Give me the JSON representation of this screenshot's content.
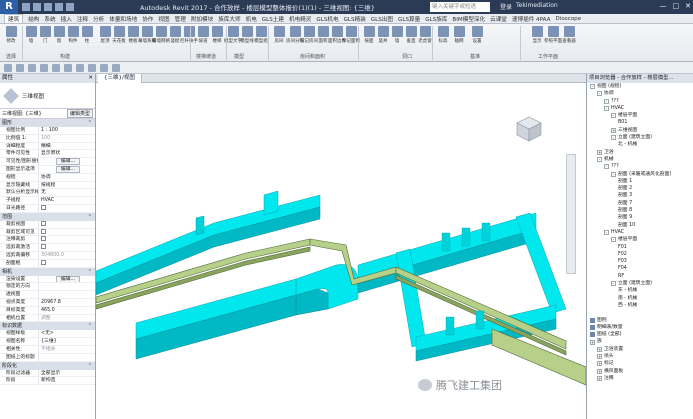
{
  "titlebar": {
    "logo": "R",
    "title": "Autodesk Revit 2017 -      合作放样 - 楼层模型整体报价(1)(1) - 三维视图: {三维}",
    "search_placeholder": "键入关键字或短语",
    "right_items": [
      "登录",
      "Tekimediation"
    ],
    "window_controls": [
      "—",
      "□",
      "✕"
    ]
  },
  "tabs": [
    "建筑",
    "结构",
    "系统",
    "插入",
    "注释",
    "分析",
    "体量和场地",
    "协作",
    "视图",
    "管理",
    "附加模块",
    "族库大师",
    "机电",
    "GLS土建",
    "机电精灵",
    "GLS机电",
    "GLS精装",
    "GLS出图",
    "GLS算量",
    "GLS族库",
    "BIM模型深化",
    "云课堂",
    "速博插件 4PAA",
    "Dioscope"
  ],
  "active_tab": "建筑",
  "ribbon": {
    "buttons": [
      "修改",
      "墙",
      "门",
      "窗",
      "构件",
      "柱",
      "屋顶",
      "天花板",
      "楼板",
      "幕墙系统",
      "幕墙网格",
      "竖梃",
      "栏杆扶手",
      "坡道",
      "楼梯",
      "模型文字",
      "模型线",
      "模型组",
      "房间",
      "房间分隔",
      "标记房间",
      "面积",
      "面积边界",
      "标记面积",
      "按面",
      "竖井",
      "墙",
      "垂直",
      "老虎窗",
      "标高",
      "轴网",
      "设置",
      "显示",
      "参照平面",
      "查看器"
    ],
    "groups": [
      "选择",
      "构建",
      "楼梯坡道",
      "模型",
      "房间和面积",
      "洞口",
      "基准",
      "工作平面"
    ]
  },
  "properties": {
    "header": "属性",
    "close": "✕",
    "type_name": "三维视图",
    "view_selector": "三维视图: {三维}",
    "edit_type": "编辑类型",
    "categories": [
      {
        "name": "图形",
        "rows": [
          {
            "k": "视图比例",
            "v": "1 : 100"
          },
          {
            "k": "比例值 1:",
            "v": "100",
            "gray": true
          },
          {
            "k": "详细程度",
            "v": "精细"
          },
          {
            "k": "零件可见性",
            "v": "显示原状"
          },
          {
            "k": "可见性/图形替换",
            "v": "编辑...",
            "button": true
          },
          {
            "k": "图形显示选项",
            "v": "编辑...",
            "button": true
          },
          {
            "k": "规程",
            "v": "协调"
          },
          {
            "k": "显示隐藏线",
            "v": "按规程"
          },
          {
            "k": "默认分析显示样式",
            "v": "无"
          },
          {
            "k": "子规程",
            "v": "HVAC"
          },
          {
            "k": "日光路径",
            "v": "",
            "checkbox": true
          }
        ]
      },
      {
        "name": "范围",
        "rows": [
          {
            "k": "裁剪视图",
            "v": "",
            "checkbox": true
          },
          {
            "k": "裁剪区域可见",
            "v": "",
            "checkbox": true
          },
          {
            "k": "注释裁剪",
            "v": "",
            "checkbox": true
          },
          {
            "k": "远剪裁激活",
            "v": "",
            "checkbox": true
          },
          {
            "k": "远剪裁偏移",
            "v": "304800.0",
            "gray": true
          },
          {
            "k": "剖面框",
            "v": "",
            "checkbox": true
          }
        ]
      },
      {
        "name": "相机",
        "rows": [
          {
            "k": "渲染设置",
            "v": "编辑...",
            "button": true
          },
          {
            "k": "锁定的方向",
            "v": "",
            "gray": true
          },
          {
            "k": "透视图",
            "v": "",
            "gray": true
          },
          {
            "k": "视点高度",
            "v": "20967.8"
          },
          {
            "k": "目标高度",
            "v": "465.0"
          },
          {
            "k": "相机位置",
            "v": "调整",
            "gray": true
          }
        ]
      },
      {
        "name": "标识数据",
        "rows": [
          {
            "k": "视图样板",
            "v": "<无>"
          },
          {
            "k": "视图名称",
            "v": "{三维}"
          },
          {
            "k": "相关性",
            "v": "不相关",
            "gray": true
          },
          {
            "k": "图纸上的标题",
            "v": ""
          }
        ]
      },
      {
        "name": "阶段化",
        "rows": [
          {
            "k": "阶段过滤器",
            "v": "全部显示"
          },
          {
            "k": "阶段",
            "v": "新构造"
          }
        ]
      }
    ]
  },
  "viewport": {
    "tab_label": "{三维}/视图",
    "watermark": "腾飞建工集团"
  },
  "browser": {
    "header": "项目浏览器 - 合作放样 - 楼层模型...",
    "nodes": [
      {
        "label": "视图 (规程)",
        "level": 0,
        "toggle": "-"
      },
      {
        "label": "协调",
        "level": 1,
        "toggle": "-"
      },
      {
        "label": "???",
        "level": 2,
        "toggle": "-"
      },
      {
        "label": "HVAC",
        "level": 2,
        "toggle": "-"
      },
      {
        "label": "楼层平面",
        "level": 3,
        "toggle": "-"
      },
      {
        "label": "B01",
        "level": 4
      },
      {
        "label": "三维视图",
        "level": 3,
        "toggle": "+"
      },
      {
        "label": "立面 (建筑立面)",
        "level": 3,
        "toggle": "-"
      },
      {
        "label": "北 - 机械",
        "level": 4
      },
      {
        "label": "卫浴",
        "level": 1,
        "toggle": "+"
      },
      {
        "label": "机械",
        "level": 1,
        "toggle": "-"
      },
      {
        "label": "???",
        "level": 2,
        "toggle": "-"
      },
      {
        "label": "剖面 (采暖或通风化剖面)",
        "level": 3,
        "toggle": "-"
      },
      {
        "label": "剖面 1",
        "level": 4
      },
      {
        "label": "剖面 2",
        "level": 4
      },
      {
        "label": "剖面 3",
        "level": 4
      },
      {
        "label": "剖面 7",
        "level": 4
      },
      {
        "label": "剖面 8",
        "level": 4
      },
      {
        "label": "剖面 9",
        "level": 4
      },
      {
        "label": "剖面 10",
        "level": 4
      },
      {
        "label": "HVAC",
        "level": 2,
        "toggle": "-"
      },
      {
        "label": "楼层平面",
        "level": 3,
        "toggle": "-"
      },
      {
        "label": "F01",
        "level": 4
      },
      {
        "label": "F02",
        "level": 4
      },
      {
        "label": "F03",
        "level": 4
      },
      {
        "label": "F04",
        "level": 4
      },
      {
        "label": "RF",
        "level": 4
      },
      {
        "label": "立面 (建筑立面)",
        "level": 3,
        "toggle": "-"
      },
      {
        "label": "东 - 机械",
        "level": 4
      },
      {
        "label": "南 - 机械",
        "level": 4
      },
      {
        "label": "西 - 机械",
        "level": 4
      },
      {
        "label": "",
        "level": 0
      },
      {
        "label": "图例",
        "level": 0,
        "icon": true
      },
      {
        "label": "明细表/数量",
        "level": 0,
        "icon": true
      },
      {
        "label": "图纸 (全部)",
        "level": 0,
        "icon": true
      },
      {
        "label": "族",
        "level": 0,
        "toggle": "+"
      },
      {
        "label": "卫浴装置",
        "level": 1,
        "toggle": "+"
      },
      {
        "label": "喷头",
        "level": 1,
        "toggle": "+"
      },
      {
        "label": "标记",
        "level": 1,
        "toggle": "+"
      },
      {
        "label": "横风面板",
        "level": 1,
        "toggle": "+"
      },
      {
        "label": "注释",
        "level": 1,
        "toggle": "+"
      }
    ]
  },
  "colors": {
    "duct": "#00e8ee",
    "duct_dark": "#00b9c4",
    "pipe": "#b6d08a",
    "pipe_dark": "#4f6a35",
    "selection": "#2d5ea8"
  }
}
